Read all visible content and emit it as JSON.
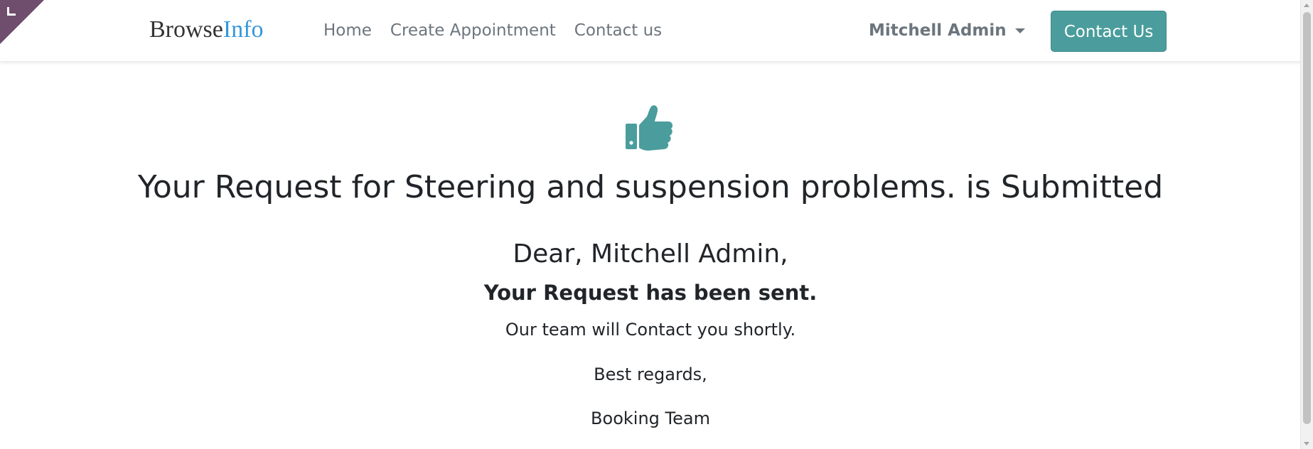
{
  "header": {
    "logo_part1": "Browse",
    "logo_part2": "Info",
    "nav": [
      "Home",
      "Create Appointment",
      "Contact us"
    ],
    "user_name": "Mitchell Admin",
    "cta_label": "Contact Us"
  },
  "confirmation": {
    "title": "Your Request for Steering and suspension problems. is Submitted",
    "greeting": "Dear, Mitchell Admin,",
    "sent_message": "Your Request has been sent.",
    "follow_up": "Our team will Contact you shortly.",
    "closing": "Best regards,",
    "signature": "Booking Team"
  },
  "icons": {
    "corner": "corner-expand-icon",
    "confirmation": "thumbs-up-icon"
  },
  "colors": {
    "accent": "#4a9d9c",
    "logo_accent": "#3498db",
    "corner_badge": "#6f4d6c"
  }
}
